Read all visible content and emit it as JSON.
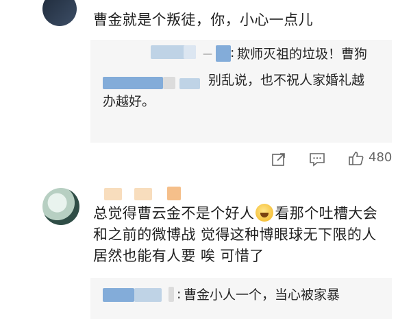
{
  "comment1": {
    "text": "曹金就是个叛徒，你，小心一点儿",
    "replies": [
      {
        "text": "欺师灭祖的垃圾！曹狗"
      },
      {
        "line1": "别乱说，也不祝人家婚礼越",
        "line2": "办越好。"
      }
    ],
    "reply1_prefix": ":",
    "like_count": "480"
  },
  "comment2": {
    "line1": "总觉得曹云金不是个好人",
    "line1b": "看那个吐槽大会",
    "line2": "和之前的微博战 觉得这种博眼球无下限的人",
    "line3": "居然也能有人要 唉 可惜了",
    "reply_text": "曹金小人一个，当心被家暴",
    "reply_prefix": ":"
  },
  "icons": {
    "share": "share-icon",
    "comment": "comment-icon",
    "like": "thumbs-up-icon",
    "emoji": "laughing-emoji-icon"
  }
}
